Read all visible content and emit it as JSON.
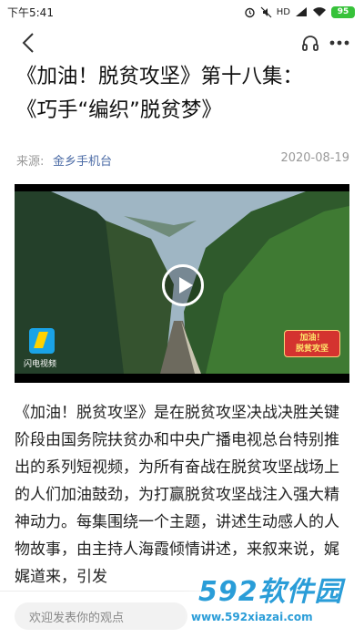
{
  "status_bar": {
    "time": "下午5:41",
    "network": "HD",
    "battery": "95"
  },
  "nav": {
    "back_icon": "chevron-left-icon",
    "listen_icon": "headphones-icon",
    "more_icon": "more-dots-icon"
  },
  "article": {
    "title_line1": "《加油！脱贫攻坚》第十八集：",
    "title_line2": "《巧手“编织”脱贫梦》",
    "source_label": "来源:",
    "source_name": "金乡手机台",
    "date": "2020-08-19",
    "body": "《加油！脱贫攻坚》是在脱贫攻坚决战决胜关键阶段由国务院扶贫办和中央广播电视总台特别推出的系列短视频，为所有奋战在脱贫攻坚战场上的人们加油鼓劲，为打赢脱贫攻坚战注入强大精神动力。每集围绕一个主题，讲述生动感人的人物故事，由主持人海霞倾情讲述，来叙来说，娓娓道来，引发"
  },
  "video": {
    "channel_name": "闪电视频",
    "show_logo_line1": "加油！",
    "show_logo_line2": "脱贫攻坚"
  },
  "comment": {
    "placeholder": "欢迎发表你的观点"
  },
  "watermark": {
    "brand": "592软件园",
    "url": "www.592xiazai.com"
  },
  "colors": {
    "source_link": "#4a6aa5",
    "watermark": "#2a9dd8",
    "battery": "#37c23a"
  }
}
